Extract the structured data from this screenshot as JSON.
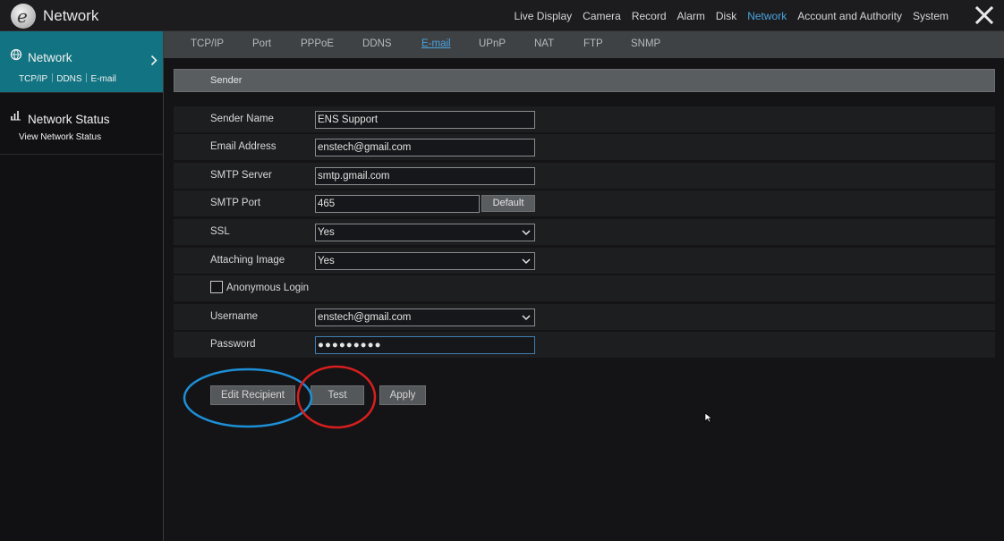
{
  "app": {
    "title": "Network"
  },
  "top_nav": [
    "Live Display",
    "Camera",
    "Record",
    "Alarm",
    "Disk",
    "Network",
    "Account and Authority",
    "System"
  ],
  "top_nav_active": "Network",
  "sidebar": {
    "items": [
      {
        "title": "Network",
        "subtitle": "TCP/IP｜DDNS｜E-mail",
        "active": true
      },
      {
        "title": "Network Status",
        "subtitle": "View Network Status",
        "active": false
      }
    ]
  },
  "tabs": [
    "TCP/IP",
    "Port",
    "PPPoE",
    "DDNS",
    "E-mail",
    "UPnP",
    "NAT",
    "FTP",
    "SNMP"
  ],
  "active_tab": "E-mail",
  "section": {
    "title": "Sender"
  },
  "form": {
    "sender_name": {
      "label": "Sender Name",
      "value": "ENS Support"
    },
    "email_address": {
      "label": "Email Address",
      "value": "enstech@gmail.com"
    },
    "smtp_server": {
      "label": "SMTP Server",
      "value": "smtp.gmail.com"
    },
    "smtp_port": {
      "label": "SMTP Port",
      "value": "465",
      "default_label": "Default"
    },
    "ssl": {
      "label": "SSL",
      "value": "Yes"
    },
    "attaching_image": {
      "label": "Attaching Image",
      "value": "Yes"
    },
    "anonymous_login": {
      "label": "Anonymous Login",
      "checked": false
    },
    "username": {
      "label": "Username",
      "value": "enstech@gmail.com"
    },
    "password": {
      "label": "Password",
      "value": "●●●●●●●●●"
    }
  },
  "buttons": {
    "edit_recipient": "Edit Recipient",
    "test": "Test",
    "apply": "Apply"
  },
  "colors": {
    "accent": "#4aa3df",
    "sidebar_active": "#127482",
    "annotation_blue": "#1e8fd6",
    "annotation_red": "#d81e1e"
  }
}
